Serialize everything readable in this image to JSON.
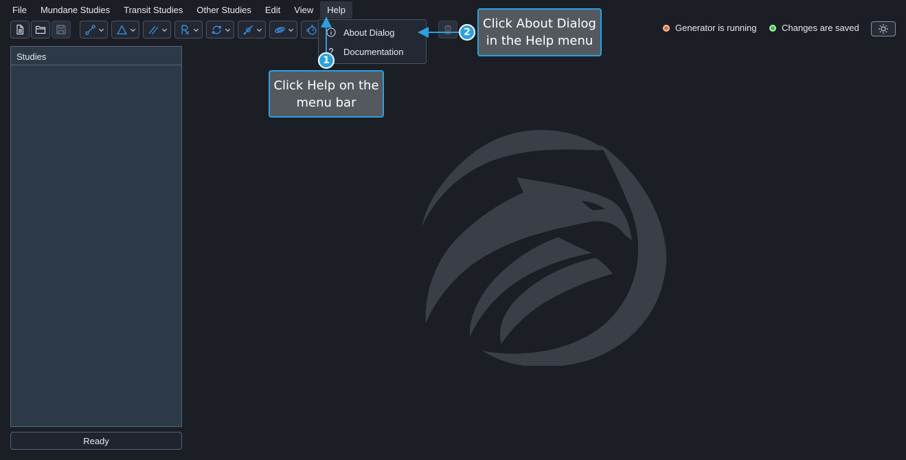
{
  "menubar": {
    "items": [
      "File",
      "Mundane Studies",
      "Transit Studies",
      "Other Studies",
      "Edit",
      "View",
      "Help"
    ],
    "active": "Help"
  },
  "toolbar": {
    "buttons": [
      "new-file-icon",
      "open-folder-icon",
      "save-icon"
    ],
    "dropdowns": [
      "aspect-link-icon",
      "triangle-icon",
      "parallel-lines-icon",
      "prescription-icon",
      "cycle-icon",
      "planet-icon",
      "ring-icon",
      "timer-icon"
    ]
  },
  "help_menu": {
    "items": [
      {
        "label": "About Dialog",
        "icon": "info-icon"
      },
      {
        "label": "Documentation",
        "icon": "question-icon"
      }
    ]
  },
  "status": {
    "generator": "Generator is running",
    "saved": "Changes are saved",
    "generator_color": "#e8693f",
    "saved_color": "#35c24a"
  },
  "sidebar": {
    "title": "Studies",
    "status_text": "Ready"
  },
  "callouts": {
    "step1": {
      "number": "1",
      "text": "Click Help on the menu bar"
    },
    "step2": {
      "number": "2",
      "text": "Click About Dialog in the Help menu"
    }
  },
  "colors": {
    "background": "#1b1e25",
    "panel": "#2c3947",
    "accent": "#2aa2e0"
  }
}
